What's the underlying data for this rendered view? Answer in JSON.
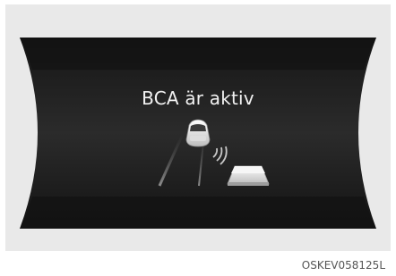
{
  "display": {
    "message": "BCA är aktiv",
    "icon": "blind-spot-collision-avoidance-icon",
    "screen_color": "#222222",
    "frame_color": "#e9e9e9"
  },
  "figure": {
    "code": "OSKEV058125L"
  }
}
